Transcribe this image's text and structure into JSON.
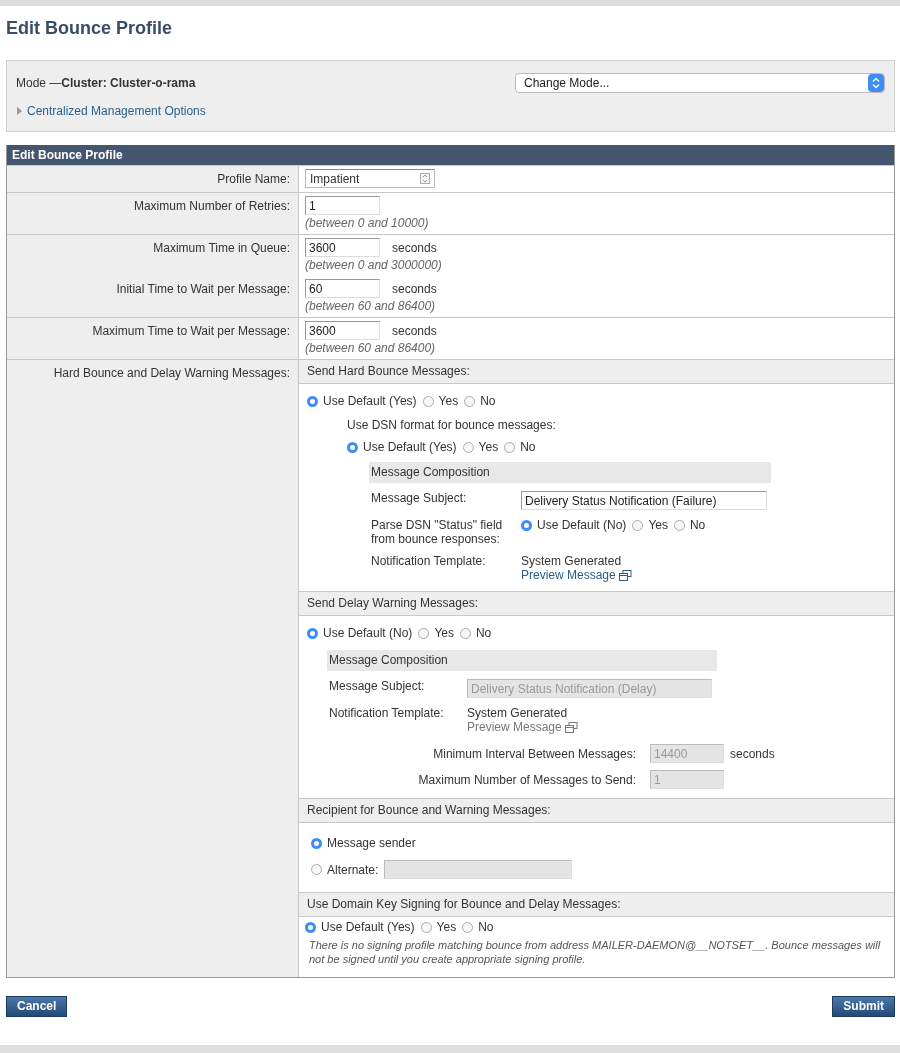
{
  "page_title": "Edit Bounce Profile",
  "mode": {
    "text": "Mode —**Cluster: Cluster-o-rama**",
    "select": "Change Mode...",
    "options_link": "Centralized Management Options",
    "expanded": false
  },
  "form": {
    "title": "Edit Bounce Profile",
    "rows": [
      {
        "items": [
          {
            "label": "Profile Name:",
            "value": "Impatient",
            "kind": "name"
          }
        ]
      },
      {
        "items": [
          {
            "label": "Maximum Number of Retries:",
            "value": "1",
            "hint": "(between 0 and 10000)"
          }
        ]
      },
      {
        "items": [
          {
            "label": "Maximum Time in Queue:",
            "value": "3600",
            "unit": "seconds",
            "hint": "(between 0 and 3000000)"
          },
          {
            "label": "Initial Time to Wait per Message:",
            "value": "60",
            "unit": "seconds",
            "hint": "(between 60 and 86400)"
          }
        ]
      },
      {
        "items": [
          {
            "label": "Maximum Time to Wait per Message:",
            "value": "3600",
            "unit": "seconds",
            "hint": "(between 60 and 86400)"
          }
        ]
      }
    ],
    "messages": {
      "label": "Hard Bounce and Delay Warning Messages:",
      "hard_bounce": {
        "title": "Send Hard Bounce Messages:",
        "options": [
          {
            "label": "Use Default (Yes)",
            "selected": true
          },
          {
            "label": "Yes",
            "selected": false
          },
          {
            "label": "No",
            "selected": false
          }
        ],
        "dsn": {
          "label": "Use DSN format for bounce messages:",
          "options": [
            {
              "label": "Use Default (Yes)",
              "selected": true
            },
            {
              "label": "Yes",
              "selected": false
            },
            {
              "label": "No",
              "selected": false
            }
          ]
        },
        "composition": {
          "title": "Message Composition",
          "subject_label": "Message Subject:",
          "subject": {
            "value": "Delivery Status Notification (Failure)",
            "disabled": false
          },
          "parse_label": "Parse DSN \"Status\" field from bounce responses:",
          "parse_options": [
            {
              "label": "Use Default (No)",
              "selected": true
            },
            {
              "label": "Yes",
              "selected": false
            },
            {
              "label": "No",
              "selected": false
            }
          ],
          "template_label": "Notification Template:",
          "template": "System Generated",
          "preview": {
            "label": "Preview Message",
            "disabled": false
          }
        }
      },
      "delay_warning": {
        "title": "Send Delay Warning Messages:",
        "options": [
          {
            "label": "Use Default (No)",
            "selected": true
          },
          {
            "label": "Yes",
            "selected": false
          },
          {
            "label": "No",
            "selected": false
          }
        ],
        "composition": {
          "title": "Message Composition",
          "subject_label": "Message Subject:",
          "subject": {
            "value": "Delivery Status Notification (Delay)",
            "disabled": true
          },
          "template_label": "Notification Template:",
          "template": "System Generated",
          "preview": {
            "label": "Preview Message",
            "disabled": true
          }
        },
        "settings": [
          {
            "label": "Minimum Interval Between Messages:",
            "value": "14400",
            "unit": "seconds",
            "disabled": true
          },
          {
            "label": "Maximum Number of Messages to Send:",
            "value": "1",
            "disabled": true
          }
        ]
      },
      "recipient": {
        "title": "Recipient for Bounce and Warning Messages:",
        "options": [
          {
            "label": "Message sender",
            "selected": true
          },
          {
            "label": "Alternate:",
            "selected": false,
            "kind": "field",
            "field_disabled": true
          }
        ]
      },
      "signing": {
        "title": "Use Domain Key Signing for Bounce and Delay Messages:",
        "options": [
          {
            "label": "Use Default (Yes)",
            "selected": true
          },
          {
            "label": "Yes",
            "selected": false
          },
          {
            "label": "No",
            "selected": false
          }
        ],
        "note": "There is no signing profile matching bounce from address MAILER-DAEMON@__NOTSET__. Bounce messages will not be signed until you create appropriate signing profile."
      }
    }
  },
  "buttons": {
    "cancel": "Cancel",
    "submit": "Submit"
  }
}
